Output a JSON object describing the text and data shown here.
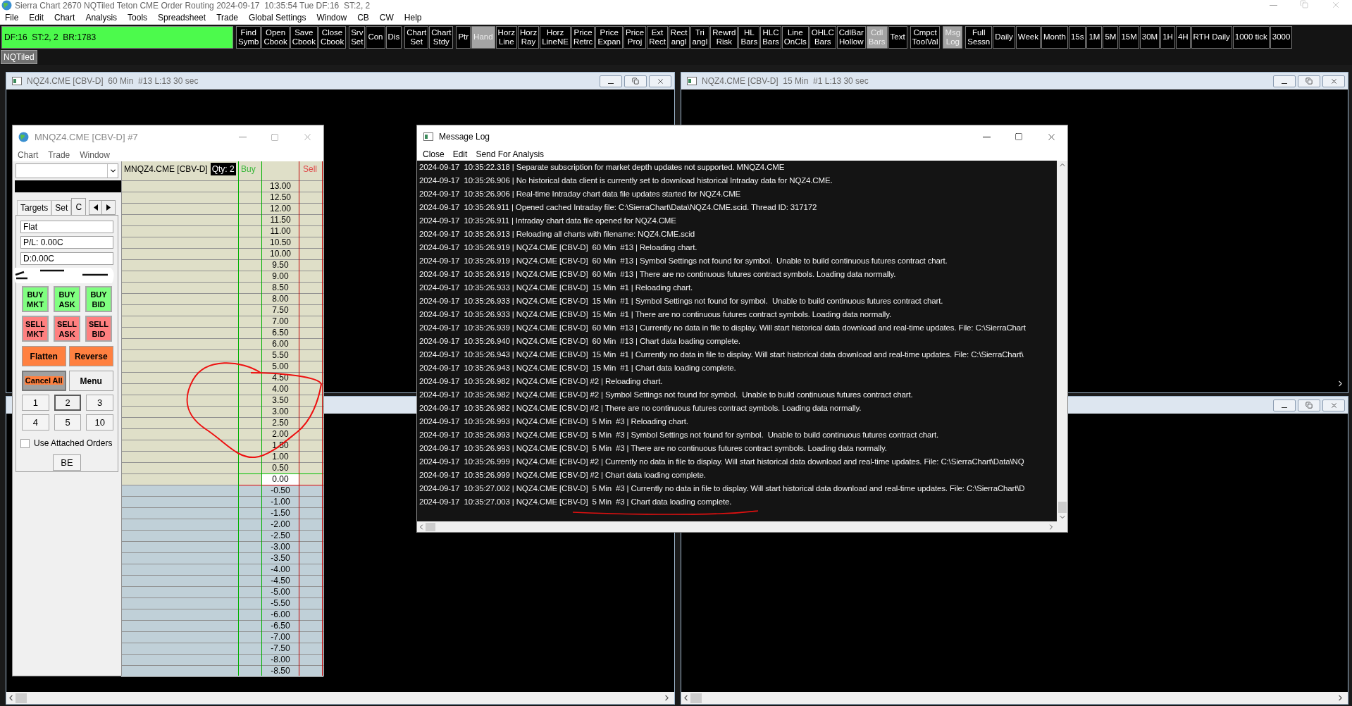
{
  "app_title": "Sierra Chart 2670 NQTiled Teton CME Order Routing 2024-09-17  10:35:54 Tue DF:16  ST:2, 2",
  "menu": [
    "File",
    "Edit",
    "Chart",
    "Analysis",
    "Tools",
    "Spreadsheet",
    "Trade",
    "Global Settings",
    "Window",
    "CB",
    "CW",
    "Help"
  ],
  "status": "DF:16  ST:2, 2  BR:1783",
  "toolbar_groups": [
    [
      {
        "lines": [
          "Find",
          "Symb"
        ],
        "selected": false
      },
      {
        "lines": [
          "Open",
          "Cbook"
        ],
        "selected": false
      },
      {
        "lines": [
          "Save",
          "Cbook"
        ],
        "selected": false
      },
      {
        "lines": [
          "Close",
          "Cbook"
        ],
        "selected": false
      }
    ],
    [
      {
        "lines": [
          "Srv",
          "Set"
        ],
        "selected": false
      },
      {
        "lines": [
          "Con"
        ],
        "selected": false
      },
      {
        "lines": [
          "Dis"
        ],
        "selected": false
      }
    ],
    [
      {
        "lines": [
          "Chart",
          "Set"
        ],
        "selected": false
      },
      {
        "lines": [
          "Chart",
          "Stdy"
        ],
        "selected": false
      }
    ],
    [
      {
        "lines": [
          "Ptr"
        ],
        "selected": false
      },
      {
        "lines": [
          "Hand"
        ],
        "selected": true
      },
      {
        "lines": [
          "Horz",
          "Line"
        ],
        "selected": false
      },
      {
        "lines": [
          "Horz",
          "Ray"
        ],
        "selected": false
      },
      {
        "lines": [
          "Horz",
          "LineNE"
        ],
        "selected": false
      },
      {
        "lines": [
          "Price",
          "Retrc"
        ],
        "selected": false
      },
      {
        "lines": [
          "Price",
          "Expan"
        ],
        "selected": false
      },
      {
        "lines": [
          "Price",
          "Proj"
        ],
        "selected": false
      },
      {
        "lines": [
          "Ext",
          "Rect"
        ],
        "selected": false
      },
      {
        "lines": [
          "Rect",
          "angl"
        ],
        "selected": false
      },
      {
        "lines": [
          "Tri",
          "angl"
        ],
        "selected": false
      },
      {
        "lines": [
          "Rewrd",
          "Risk"
        ],
        "selected": false
      },
      {
        "lines": [
          "HL",
          "Bars"
        ],
        "selected": false
      },
      {
        "lines": [
          "HLC",
          "Bars"
        ],
        "selected": false
      },
      {
        "lines": [
          "Line",
          "OnCls"
        ],
        "selected": false
      },
      {
        "lines": [
          "OHLC",
          "Bars"
        ],
        "selected": false
      },
      {
        "lines": [
          "CdlBar",
          "Hollow"
        ],
        "selected": false
      },
      {
        "lines": [
          "Cdl",
          "Bars"
        ],
        "selected": true
      },
      {
        "lines": [
          "Text"
        ],
        "selected": false
      }
    ],
    [
      {
        "lines": [
          "Cmpct",
          "ToolVal"
        ],
        "selected": false
      }
    ],
    [
      {
        "lines": [
          "Msg",
          "Log"
        ],
        "selected": true
      }
    ],
    [
      {
        "lines": [
          "Full",
          "Sessn"
        ],
        "selected": false
      },
      {
        "lines": [
          "Daily"
        ],
        "selected": false
      },
      {
        "lines": [
          "Week"
        ],
        "selected": false
      },
      {
        "lines": [
          "Month"
        ],
        "selected": false
      },
      {
        "lines": [
          "15s"
        ],
        "selected": false
      },
      {
        "lines": [
          "1M"
        ],
        "selected": false
      },
      {
        "lines": [
          "5M"
        ],
        "selected": false
      },
      {
        "lines": [
          "15M"
        ],
        "selected": false
      },
      {
        "lines": [
          "30M"
        ],
        "selected": false
      },
      {
        "lines": [
          "1H"
        ],
        "selected": false
      },
      {
        "lines": [
          "4H"
        ],
        "selected": false
      },
      {
        "lines": [
          "RTH Daily"
        ],
        "selected": false
      },
      {
        "lines": [
          "1000 tick"
        ],
        "selected": false
      },
      {
        "lines": [
          "3000"
        ],
        "selected": false
      }
    ]
  ],
  "tabs": [
    {
      "label": "NQTiled",
      "selected": true
    }
  ],
  "chart_windows": [
    {
      "title": "NQZ4.CME [CBV-D]  60 Min  #13 L:13 30 sec"
    },
    {
      "title": "NQZ4.CME [CBV-D]  15 Min  #1 L:13 30 sec"
    }
  ],
  "trade_window": {
    "title": "MNQZ4.CME [CBV-D] #7",
    "menu": [
      "Chart",
      "Trade",
      "Window"
    ],
    "tabs": [
      {
        "label": "Targets",
        "selected": false
      },
      {
        "label": "Set",
        "selected": false
      },
      {
        "label": "C",
        "selected": true
      }
    ],
    "position": "Flat",
    "profit_loss": "P/L: 0.00C",
    "daily": "D:0.00C",
    "buy_buttons": [
      {
        "lines": [
          "BUY",
          "MKT"
        ]
      },
      {
        "lines": [
          "BUY",
          "ASK"
        ]
      },
      {
        "lines": [
          "BUY",
          "BID"
        ]
      }
    ],
    "sell_buttons": [
      {
        "lines": [
          "SELL",
          "MKT"
        ]
      },
      {
        "lines": [
          "SELL",
          "ASK"
        ]
      },
      {
        "lines": [
          "SELL",
          "BID"
        ]
      }
    ],
    "flatten": "Flatten",
    "reverse": "Reverse",
    "cancel_all": "Cancel All",
    "menu_button": "Menu",
    "quantities": [
      {
        "label": "1",
        "selected": false
      },
      {
        "label": "2",
        "selected": true
      },
      {
        "label": "3",
        "selected": false
      },
      {
        "label": "4",
        "selected": false
      },
      {
        "label": "5",
        "selected": false
      },
      {
        "label": "10",
        "selected": false
      }
    ],
    "attached_orders": {
      "label": "Use Attached Orders",
      "checked": false
    },
    "be_button": "BE",
    "dom": {
      "symbol": "MNQZ4.CME [CBV-D]",
      "qty": "Qty: 2",
      "buy_header": "Buy",
      "sell_header": "Sell",
      "prices": [
        {
          "price": "13.00",
          "current": false
        },
        {
          "price": "12.50",
          "current": false
        },
        {
          "price": "12.00",
          "current": false
        },
        {
          "price": "11.50",
          "current": false
        },
        {
          "price": "11.00",
          "current": false
        },
        {
          "price": "10.50",
          "current": false
        },
        {
          "price": "10.00",
          "current": false
        },
        {
          "price": "9.50",
          "current": false
        },
        {
          "price": "9.00",
          "current": false
        },
        {
          "price": "8.50",
          "current": false
        },
        {
          "price": "8.00",
          "current": false
        },
        {
          "price": "7.50",
          "current": false
        },
        {
          "price": "7.00",
          "current": false
        },
        {
          "price": "6.50",
          "current": false
        },
        {
          "price": "6.00",
          "current": false
        },
        {
          "price": "5.50",
          "current": false
        },
        {
          "price": "5.00",
          "current": false
        },
        {
          "price": "4.50",
          "current": false
        },
        {
          "price": "4.00",
          "current": false
        },
        {
          "price": "3.50",
          "current": false
        },
        {
          "price": "3.00",
          "current": false
        },
        {
          "price": "2.50",
          "current": false
        },
        {
          "price": "2.00",
          "current": false
        },
        {
          "price": "1.50",
          "current": false
        },
        {
          "price": "1.00",
          "current": false
        },
        {
          "price": "0.50",
          "current": false
        },
        {
          "price": "0.00",
          "current": true
        },
        {
          "price": "-0.50",
          "current": false
        },
        {
          "price": "-1.00",
          "current": false
        },
        {
          "price": "-1.50",
          "current": false
        },
        {
          "price": "-2.00",
          "current": false
        },
        {
          "price": "-2.50",
          "current": false
        },
        {
          "price": "-3.00",
          "current": false
        },
        {
          "price": "-3.50",
          "current": false
        },
        {
          "price": "-4.00",
          "current": false
        },
        {
          "price": "-4.50",
          "current": false
        },
        {
          "price": "-5.00",
          "current": false
        },
        {
          "price": "-5.50",
          "current": false
        },
        {
          "price": "-6.00",
          "current": false
        },
        {
          "price": "-6.50",
          "current": false
        },
        {
          "price": "-7.00",
          "current": false
        },
        {
          "price": "-7.50",
          "current": false
        },
        {
          "price": "-8.00",
          "current": false
        },
        {
          "price": "-8.50",
          "current": false
        }
      ]
    }
  },
  "message_log": {
    "title": "Message Log",
    "menu": [
      "Close",
      "Edit",
      "Send For Analysis"
    ],
    "lines": [
      "2024-09-17  10:35:22.318 | Separate subscription for market depth updates not supported. MNQZ4.CME",
      "2024-09-17  10:35:26.906 | No historical data client is currently set to download historical Intraday data for NQZ4.CME.",
      "2024-09-17  10:35:26.906 | Real-time Intraday chart data file updates started for NQZ4.CME",
      "2024-09-17  10:35:26.911 | Opened cached Intraday file: C:\\SierraChart\\Data\\NQZ4.CME.scid. Thread ID: 317172",
      "2024-09-17  10:35:26.911 | Intraday chart data file opened for NQZ4.CME",
      "2024-09-17  10:35:26.913 | Reloading all charts with filename: NQZ4.CME.scid",
      "2024-09-17  10:35:26.919 | NQZ4.CME [CBV-D]  60 Min  #13 | Reloading chart.",
      "2024-09-17  10:35:26.919 | NQZ4.CME [CBV-D]  60 Min  #13 | Symbol Settings not found for symbol.  Unable to build continuous futures contract chart.",
      "2024-09-17  10:35:26.919 | NQZ4.CME [CBV-D]  60 Min  #13 | There are no continuous futures contract symbols. Loading data normally.",
      "2024-09-17  10:35:26.933 | NQZ4.CME [CBV-D]  15 Min  #1 | Reloading chart.",
      "2024-09-17  10:35:26.933 | NQZ4.CME [CBV-D]  15 Min  #1 | Symbol Settings not found for symbol.  Unable to build continuous futures contract chart.",
      "2024-09-17  10:35:26.933 | NQZ4.CME [CBV-D]  15 Min  #1 | There are no continuous futures contract symbols. Loading data normally.",
      "2024-09-17  10:35:26.939 | NQZ4.CME [CBV-D]  60 Min  #13 | Currently no data in file to display. Will start historical data download and real-time updates. File: C:\\SierraChart",
      "2024-09-17  10:35:26.940 | NQZ4.CME [CBV-D]  60 Min  #13 | Chart data loading complete.",
      "2024-09-17  10:35:26.943 | NQZ4.CME [CBV-D]  15 Min  #1 | Currently no data in file to display. Will start historical data download and real-time updates. File: C:\\SierraChart\\",
      "2024-09-17  10:35:26.943 | NQZ4.CME [CBV-D]  15 Min  #1 | Chart data loading complete.",
      "2024-09-17  10:35:26.982 | NQZ4.CME [CBV-D] #2 | Reloading chart.",
      "2024-09-17  10:35:26.982 | NQZ4.CME [CBV-D] #2 | Symbol Settings not found for symbol.  Unable to build continuous futures contract chart.",
      "2024-09-17  10:35:26.982 | NQZ4.CME [CBV-D] #2 | There are no continuous futures contract symbols. Loading data normally.",
      "2024-09-17  10:35:26.993 | NQZ4.CME [CBV-D]  5 Min  #3 | Reloading chart.",
      "2024-09-17  10:35:26.993 | NQZ4.CME [CBV-D]  5 Min  #3 | Symbol Settings not found for symbol.  Unable to build continuous futures contract chart.",
      "2024-09-17  10:35:26.993 | NQZ4.CME [CBV-D]  5 Min  #3 | There are no continuous futures contract symbols. Loading data normally.",
      "2024-09-17  10:35:26.999 | NQZ4.CME [CBV-D] #2 | Currently no data in file to display. Will start historical data download and real-time updates. File: C:\\SierraChart\\Data\\NQ",
      "2024-09-17  10:35:26.999 | NQZ4.CME [CBV-D] #2 | Chart data loading complete.",
      "2024-09-17  10:35:27.002 | NQZ4.CME [CBV-D]  5 Min  #3 | Currently no data in file to display. Will start historical data download and real-time updates. File: C:\\SierraChart\\D",
      "2024-09-17  10:35:27.003 | NQZ4.CME [CBV-D]  5 Min  #3 | Chart data loading complete."
    ]
  }
}
